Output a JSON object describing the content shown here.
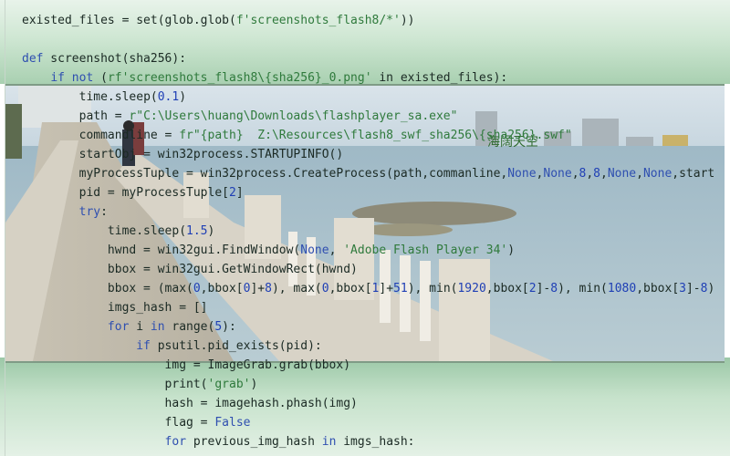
{
  "code_lines": [
    {
      "indent": 0,
      "parts": [
        {
          "t": "existed_files = set(glob.glob(",
          "c": ""
        },
        {
          "t": "f'screenshots_flash8/*'",
          "c": "str"
        },
        {
          "t": "))",
          "c": ""
        }
      ]
    },
    {
      "indent": 0,
      "parts": []
    },
    {
      "indent": 0,
      "parts": [
        {
          "t": "def",
          "c": "kw"
        },
        {
          "t": " screenshot(sha256):",
          "c": ""
        }
      ]
    },
    {
      "indent": 4,
      "parts": [
        {
          "t": "if not",
          "c": "kw"
        },
        {
          "t": " (",
          "c": ""
        },
        {
          "t": "rf'screenshots_flash8\\{sha256}_0.png'",
          "c": "str"
        },
        {
          "t": " in existed_files):",
          "c": ""
        }
      ]
    },
    {
      "indent": 8,
      "parts": [
        {
          "t": "time.sleep(",
          "c": ""
        },
        {
          "t": "0.1",
          "c": "num"
        },
        {
          "t": ")",
          "c": ""
        }
      ]
    },
    {
      "indent": 8,
      "parts": [
        {
          "t": "path = ",
          "c": ""
        },
        {
          "t": "r\"C:\\Users\\huang\\Downloads\\flashplayer_sa.exe\"",
          "c": "str"
        }
      ]
    },
    {
      "indent": 8,
      "parts": [
        {
          "t": "commandline = ",
          "c": ""
        },
        {
          "t": "fr\"{path}  Z:\\Resources\\flash8_swf_sha256\\{sha256}.swf\"",
          "c": "str"
        }
      ]
    },
    {
      "indent": 8,
      "parts": [
        {
          "t": "startObj = win32process.STARTUPINFO()",
          "c": ""
        }
      ]
    },
    {
      "indent": 8,
      "parts": [
        {
          "t": "myProcessTuple = win32process.CreateProcess(path,commanline,",
          "c": ""
        },
        {
          "t": "None",
          "c": "kw"
        },
        {
          "t": ",",
          "c": ""
        },
        {
          "t": "None",
          "c": "kw"
        },
        {
          "t": ",",
          "c": ""
        },
        {
          "t": "8",
          "c": "num"
        },
        {
          "t": ",",
          "c": ""
        },
        {
          "t": "8",
          "c": "num"
        },
        {
          "t": ",",
          "c": ""
        },
        {
          "t": "None",
          "c": "kw"
        },
        {
          "t": ",",
          "c": ""
        },
        {
          "t": "None",
          "c": "kw"
        },
        {
          "t": ",start",
          "c": ""
        }
      ]
    },
    {
      "indent": 8,
      "parts": [
        {
          "t": "pid = myProcessTuple[",
          "c": ""
        },
        {
          "t": "2",
          "c": "num"
        },
        {
          "t": "]",
          "c": ""
        }
      ]
    },
    {
      "indent": 8,
      "parts": [
        {
          "t": "try",
          "c": "kw"
        },
        {
          "t": ":",
          "c": ""
        }
      ]
    },
    {
      "indent": 12,
      "parts": [
        {
          "t": "time.sleep(",
          "c": ""
        },
        {
          "t": "1.5",
          "c": "num"
        },
        {
          "t": ")",
          "c": ""
        }
      ]
    },
    {
      "indent": 12,
      "parts": [
        {
          "t": "hwnd = win32gui.FindWindow(",
          "c": ""
        },
        {
          "t": "None",
          "c": "kw"
        },
        {
          "t": ", ",
          "c": ""
        },
        {
          "t": "'Adobe Flash Player 34'",
          "c": "str"
        },
        {
          "t": ")",
          "c": ""
        }
      ]
    },
    {
      "indent": 12,
      "parts": [
        {
          "t": "bbox = win32gui.GetWindowRect(hwnd)",
          "c": ""
        }
      ]
    },
    {
      "indent": 12,
      "parts": [
        {
          "t": "bbox = (max(",
          "c": ""
        },
        {
          "t": "0",
          "c": "num"
        },
        {
          "t": ",bbox[",
          "c": ""
        },
        {
          "t": "0",
          "c": "num"
        },
        {
          "t": "]+",
          "c": ""
        },
        {
          "t": "8",
          "c": "num"
        },
        {
          "t": "), max(",
          "c": ""
        },
        {
          "t": "0",
          "c": "num"
        },
        {
          "t": ",bbox[",
          "c": ""
        },
        {
          "t": "1",
          "c": "num"
        },
        {
          "t": "]+",
          "c": ""
        },
        {
          "t": "51",
          "c": "num"
        },
        {
          "t": "), min(",
          "c": ""
        },
        {
          "t": "1920",
          "c": "num"
        },
        {
          "t": ",bbox[",
          "c": ""
        },
        {
          "t": "2",
          "c": "num"
        },
        {
          "t": "]-",
          "c": ""
        },
        {
          "t": "8",
          "c": "num"
        },
        {
          "t": "), min(",
          "c": ""
        },
        {
          "t": "1080",
          "c": "num"
        },
        {
          "t": ",bbox[",
          "c": ""
        },
        {
          "t": "3",
          "c": "num"
        },
        {
          "t": "]-",
          "c": ""
        },
        {
          "t": "8",
          "c": "num"
        },
        {
          "t": ")",
          "c": ""
        }
      ]
    },
    {
      "indent": 12,
      "parts": [
        {
          "t": "imgs_hash = []",
          "c": ""
        }
      ]
    },
    {
      "indent": 12,
      "parts": [
        {
          "t": "for",
          "c": "kw"
        },
        {
          "t": " i ",
          "c": ""
        },
        {
          "t": "in",
          "c": "kw"
        },
        {
          "t": " range(",
          "c": ""
        },
        {
          "t": "5",
          "c": "num"
        },
        {
          "t": "):",
          "c": ""
        }
      ]
    },
    {
      "indent": 16,
      "parts": [
        {
          "t": "if",
          "c": "kw"
        },
        {
          "t": " psutil.pid_exists(pid):",
          "c": ""
        }
      ]
    },
    {
      "indent": 20,
      "parts": [
        {
          "t": "img = ImageGrab.grab(bbox)",
          "c": ""
        }
      ]
    },
    {
      "indent": 20,
      "parts": [
        {
          "t": "print(",
          "c": ""
        },
        {
          "t": "'grab'",
          "c": "str"
        },
        {
          "t": ")",
          "c": ""
        }
      ]
    },
    {
      "indent": 20,
      "parts": [
        {
          "t": "hash = imagehash.phash(img)",
          "c": ""
        }
      ]
    },
    {
      "indent": 20,
      "parts": [
        {
          "t": "flag = ",
          "c": ""
        },
        {
          "t": "False",
          "c": "kw"
        }
      ]
    },
    {
      "indent": 20,
      "parts": [
        {
          "t": "for",
          "c": "kw"
        },
        {
          "t": " previous_img_hash ",
          "c": ""
        },
        {
          "t": "in",
          "c": "kw"
        },
        {
          "t": " imgs_hash:",
          "c": ""
        }
      ]
    }
  ],
  "colors": {
    "keyword": "#2f4fb0",
    "string": "#2f7a3c",
    "number": "#1f3fb5",
    "text": "#1b2a24",
    "band_green": "#a9d0b1"
  },
  "photo": {
    "scene": "seaside-promenade-with-stone-balustrade",
    "overlay_text": "海阔天空"
  }
}
